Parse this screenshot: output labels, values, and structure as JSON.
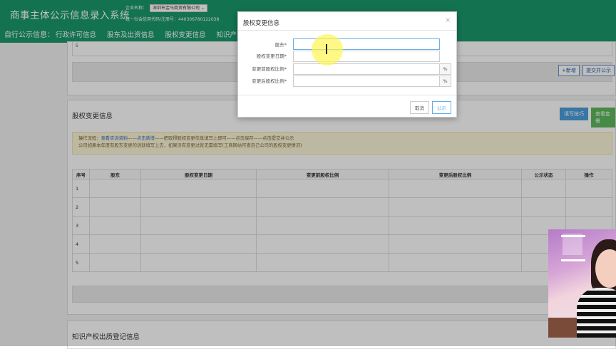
{
  "header": {
    "app_title": "商事主体公示信息录入系统",
    "company_label": "企业名称：",
    "company_value": "深圳市金马商贸有限公司",
    "credit_label": "统一社会信用代码/注册号：",
    "credit_value": "440306780122038",
    "nav_label": "自行公示信息：",
    "nav_tabs": [
      "行政许可信息",
      "股东及出资信息",
      "股权变更信息",
      "知识产"
    ]
  },
  "top_panel": {
    "row_number": "5",
    "add_button": "+新增",
    "submit_button": "提交并公示"
  },
  "equity_section": {
    "title": "股权变更信息",
    "fill_tips_button": "填写技巧",
    "view_example_button": "查看套餐",
    "notice_line1_prefix": "操作流程：",
    "notice_link1": "查看实训资料",
    "notice_sep1": "——",
    "notice_link2": "点击新增",
    "notice_line1_rest": "——把取得股权变更信息填写上即可——点击保存——点击提交并公示",
    "notice_line2": "公司如果本年度有股东变更的话就填写上去，如果没有变更过就无需填写(工商网站可查自己公司的股权变更情况)",
    "table": {
      "headers": [
        "序号",
        "股东",
        "股权变更日期",
        "变更前股权比例",
        "变更后股权比例",
        "公示状态",
        "操作"
      ],
      "rows": [
        "1",
        "2",
        "3",
        "4",
        "5"
      ]
    }
  },
  "ip_section": {
    "title": "知识产权出质登记信息"
  },
  "modal": {
    "title": "股权变更信息",
    "close": "×",
    "fields": [
      {
        "label": "股东*"
      },
      {
        "label": "股权变更日期*"
      },
      {
        "label": "变更前股权比例*",
        "suffix": "%"
      },
      {
        "label": "变更后股权比例*",
        "suffix": "%"
      }
    ],
    "cancel": "取消",
    "publish": "公示"
  }
}
